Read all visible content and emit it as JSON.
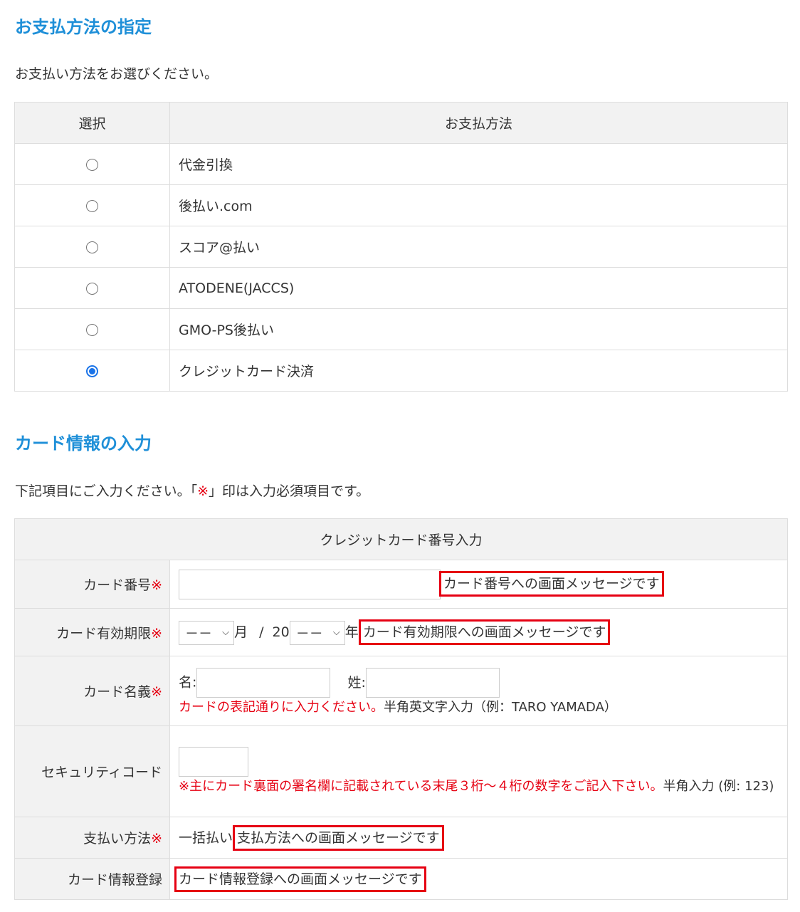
{
  "payment": {
    "heading": "お支払方法の指定",
    "lead": "お支払い方法をお選びください。",
    "col_select": "選択",
    "col_method": "お支払方法",
    "options": [
      {
        "label": "代金引換",
        "selected": false
      },
      {
        "label": "後払い.com",
        "selected": false
      },
      {
        "label": "スコア@払い",
        "selected": false
      },
      {
        "label": "ATODENE(JACCS)",
        "selected": false
      },
      {
        "label": "GMO-PS後払い",
        "selected": false
      },
      {
        "label": "クレジットカード決済",
        "selected": true
      }
    ]
  },
  "card": {
    "heading": "カード情報の入力",
    "lead_before": "下記項目にご入力ください。「",
    "lead_mark": "※",
    "lead_after": "」印は入力必須項目です。",
    "table_title": "クレジットカード番号入力",
    "required_mark": "※",
    "number": {
      "label": "カード番号",
      "value": "",
      "message": "カード番号への画面メッセージです"
    },
    "expiry": {
      "label": "カード有効期限",
      "month_value": "－－",
      "month_unit": "月",
      "separator": "/",
      "year_prefix": "20",
      "year_value": "－－",
      "year_unit": "年",
      "message": "カード有効期限への画面メッセージです"
    },
    "holder": {
      "label": "カード名義",
      "first_label": "名:",
      "last_label": "姓:",
      "first_value": "",
      "last_value": "",
      "note_red": "カードの表記通りに入力ください。",
      "note": "半角英文字入力（例：TARO YAMADA）"
    },
    "security": {
      "label": "セキュリティコード",
      "value": "",
      "note_red": "※主にカード裏面の署名欄に記載されている末尾３桁～４桁の数字をご記入下さい。",
      "note": "半角入力 (例: 123)"
    },
    "pay_method": {
      "label": "支払い方法",
      "value": "一括払い",
      "message": "支払方法への画面メッセージです"
    },
    "register": {
      "label": "カード情報登録",
      "message": "カード情報登録への画面メッセージです"
    }
  },
  "colors": {
    "heading": "#1e8fd8",
    "required": "#e60012",
    "radio_selected": "#1a73e8",
    "header_bg": "#f2f2f2"
  }
}
